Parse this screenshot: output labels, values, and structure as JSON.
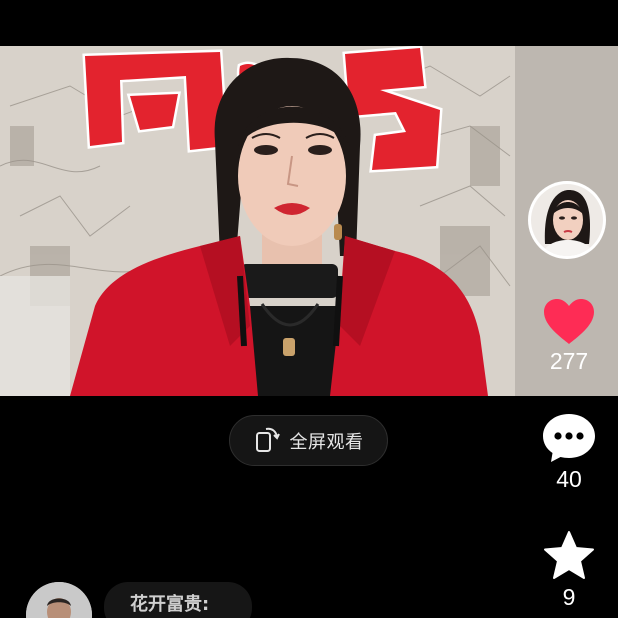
{
  "player": {
    "fullscreen_label": "全屏观看"
  },
  "author": {
    "avatar_icon": "author-avatar"
  },
  "actions": {
    "like": {
      "icon": "heart-icon",
      "count": "277",
      "color": "#fe2c55"
    },
    "comment": {
      "icon": "comment-dots-icon",
      "count": "40"
    },
    "favorite": {
      "icon": "star-icon",
      "count": "9"
    }
  },
  "comment_preview": {
    "author": "花开富贵:"
  },
  "colors": {
    "background": "#000000",
    "jacket_red": "#d0142a",
    "banner_red": "#e3232e"
  }
}
